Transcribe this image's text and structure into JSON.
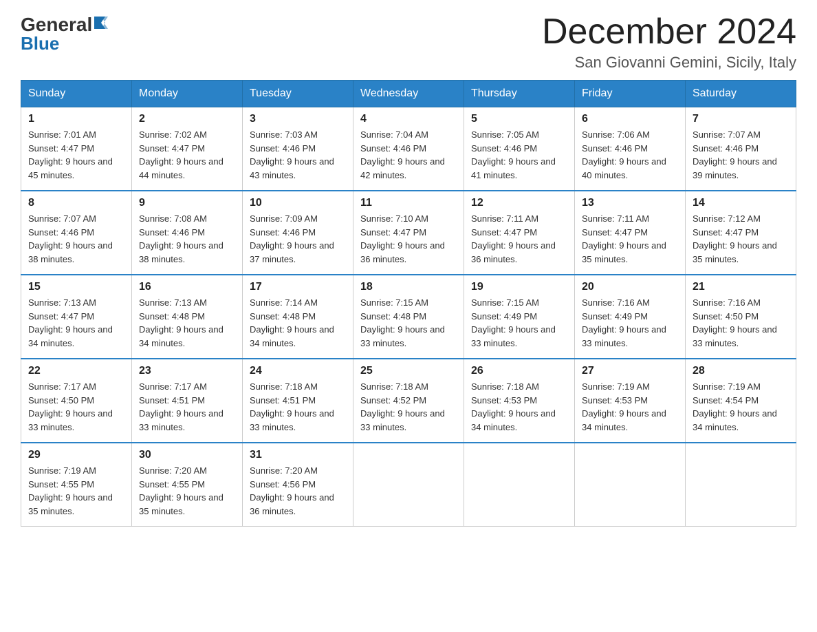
{
  "header": {
    "logo_top": "General",
    "logo_bottom": "Blue",
    "month_title": "December 2024",
    "location": "San Giovanni Gemini, Sicily, Italy"
  },
  "weekdays": [
    "Sunday",
    "Monday",
    "Tuesday",
    "Wednesday",
    "Thursday",
    "Friday",
    "Saturday"
  ],
  "weeks": [
    [
      {
        "day": "1",
        "sunrise": "7:01 AM",
        "sunset": "4:47 PM",
        "daylight": "9 hours and 45 minutes."
      },
      {
        "day": "2",
        "sunrise": "7:02 AM",
        "sunset": "4:47 PM",
        "daylight": "9 hours and 44 minutes."
      },
      {
        "day": "3",
        "sunrise": "7:03 AM",
        "sunset": "4:46 PM",
        "daylight": "9 hours and 43 minutes."
      },
      {
        "day": "4",
        "sunrise": "7:04 AM",
        "sunset": "4:46 PM",
        "daylight": "9 hours and 42 minutes."
      },
      {
        "day": "5",
        "sunrise": "7:05 AM",
        "sunset": "4:46 PM",
        "daylight": "9 hours and 41 minutes."
      },
      {
        "day": "6",
        "sunrise": "7:06 AM",
        "sunset": "4:46 PM",
        "daylight": "9 hours and 40 minutes."
      },
      {
        "day": "7",
        "sunrise": "7:07 AM",
        "sunset": "4:46 PM",
        "daylight": "9 hours and 39 minutes."
      }
    ],
    [
      {
        "day": "8",
        "sunrise": "7:07 AM",
        "sunset": "4:46 PM",
        "daylight": "9 hours and 38 minutes."
      },
      {
        "day": "9",
        "sunrise": "7:08 AM",
        "sunset": "4:46 PM",
        "daylight": "9 hours and 38 minutes."
      },
      {
        "day": "10",
        "sunrise": "7:09 AM",
        "sunset": "4:46 PM",
        "daylight": "9 hours and 37 minutes."
      },
      {
        "day": "11",
        "sunrise": "7:10 AM",
        "sunset": "4:47 PM",
        "daylight": "9 hours and 36 minutes."
      },
      {
        "day": "12",
        "sunrise": "7:11 AM",
        "sunset": "4:47 PM",
        "daylight": "9 hours and 36 minutes."
      },
      {
        "day": "13",
        "sunrise": "7:11 AM",
        "sunset": "4:47 PM",
        "daylight": "9 hours and 35 minutes."
      },
      {
        "day": "14",
        "sunrise": "7:12 AM",
        "sunset": "4:47 PM",
        "daylight": "9 hours and 35 minutes."
      }
    ],
    [
      {
        "day": "15",
        "sunrise": "7:13 AM",
        "sunset": "4:47 PM",
        "daylight": "9 hours and 34 minutes."
      },
      {
        "day": "16",
        "sunrise": "7:13 AM",
        "sunset": "4:48 PM",
        "daylight": "9 hours and 34 minutes."
      },
      {
        "day": "17",
        "sunrise": "7:14 AM",
        "sunset": "4:48 PM",
        "daylight": "9 hours and 34 minutes."
      },
      {
        "day": "18",
        "sunrise": "7:15 AM",
        "sunset": "4:48 PM",
        "daylight": "9 hours and 33 minutes."
      },
      {
        "day": "19",
        "sunrise": "7:15 AM",
        "sunset": "4:49 PM",
        "daylight": "9 hours and 33 minutes."
      },
      {
        "day": "20",
        "sunrise": "7:16 AM",
        "sunset": "4:49 PM",
        "daylight": "9 hours and 33 minutes."
      },
      {
        "day": "21",
        "sunrise": "7:16 AM",
        "sunset": "4:50 PM",
        "daylight": "9 hours and 33 minutes."
      }
    ],
    [
      {
        "day": "22",
        "sunrise": "7:17 AM",
        "sunset": "4:50 PM",
        "daylight": "9 hours and 33 minutes."
      },
      {
        "day": "23",
        "sunrise": "7:17 AM",
        "sunset": "4:51 PM",
        "daylight": "9 hours and 33 minutes."
      },
      {
        "day": "24",
        "sunrise": "7:18 AM",
        "sunset": "4:51 PM",
        "daylight": "9 hours and 33 minutes."
      },
      {
        "day": "25",
        "sunrise": "7:18 AM",
        "sunset": "4:52 PM",
        "daylight": "9 hours and 33 minutes."
      },
      {
        "day": "26",
        "sunrise": "7:18 AM",
        "sunset": "4:53 PM",
        "daylight": "9 hours and 34 minutes."
      },
      {
        "day": "27",
        "sunrise": "7:19 AM",
        "sunset": "4:53 PM",
        "daylight": "9 hours and 34 minutes."
      },
      {
        "day": "28",
        "sunrise": "7:19 AM",
        "sunset": "4:54 PM",
        "daylight": "9 hours and 34 minutes."
      }
    ],
    [
      {
        "day": "29",
        "sunrise": "7:19 AM",
        "sunset": "4:55 PM",
        "daylight": "9 hours and 35 minutes."
      },
      {
        "day": "30",
        "sunrise": "7:20 AM",
        "sunset": "4:55 PM",
        "daylight": "9 hours and 35 minutes."
      },
      {
        "day": "31",
        "sunrise": "7:20 AM",
        "sunset": "4:56 PM",
        "daylight": "9 hours and 36 minutes."
      },
      null,
      null,
      null,
      null
    ]
  ]
}
